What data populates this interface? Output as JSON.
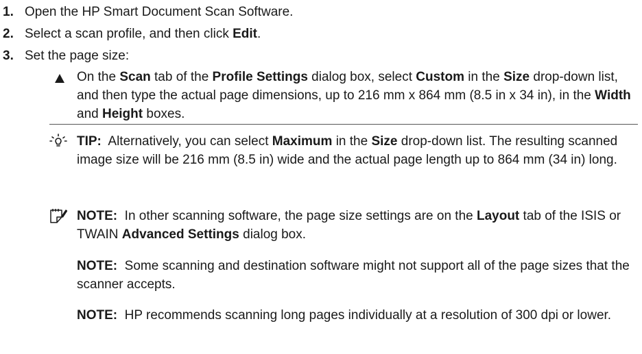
{
  "steps": [
    {
      "num": "1.",
      "text": "Open the HP Smart Document Scan Software."
    },
    {
      "num": "2.",
      "pre": "Select a scan profile, and then click ",
      "bold": "Edit",
      "post": "."
    },
    {
      "num": "3.",
      "text": "Set the page size:"
    }
  ],
  "bullet": {
    "p1": "On the ",
    "b1": "Scan",
    "p2": " tab of the ",
    "b2": "Profile Settings",
    "p3": " dialog box, select ",
    "b3": "Custom",
    "p4": " in the ",
    "b4": "Size",
    "p5": " drop-down list, and then type the actual page dimensions, up to 216 mm x 864 mm (8.5 in x 34 in), in the ",
    "b5": "Width",
    "p6": " and ",
    "b6": "Height",
    "p7": " boxes."
  },
  "tip": {
    "label": "TIP:",
    "p1": "  Alternatively, you can select ",
    "b1": "Maximum",
    "p2": " in the ",
    "b2": "Size",
    "p3": " drop-down list. The resulting scanned image size will be 216 mm (8.5 in) wide and the actual page length up to 864 mm (34 in) long."
  },
  "note1": {
    "label": "NOTE:",
    "p1": "  In other scanning software, the page size settings are on the ",
    "b1": "Layout",
    "p2": " tab of the ISIS or TWAIN ",
    "b2": "Advanced Settings",
    "p3": " dialog box."
  },
  "note2": {
    "label": "NOTE:",
    "text": "  Some scanning and destination software might not support all of the page sizes that the scanner accepts."
  },
  "note3": {
    "label": "NOTE:",
    "text": "  HP recommends scanning long pages individually at a resolution of 300 dpi or lower."
  }
}
